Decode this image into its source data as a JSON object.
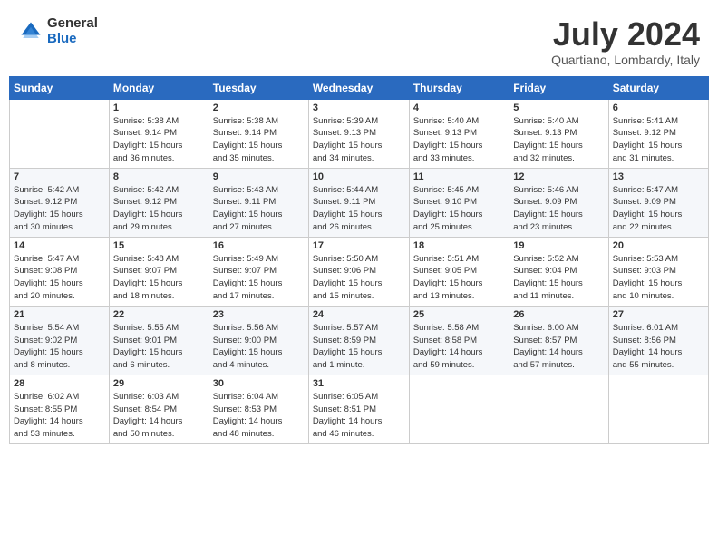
{
  "logo": {
    "general": "General",
    "blue": "Blue"
  },
  "title": {
    "month": "July 2024",
    "location": "Quartiano, Lombardy, Italy"
  },
  "days_of_week": [
    "Sunday",
    "Monday",
    "Tuesday",
    "Wednesday",
    "Thursday",
    "Friday",
    "Saturday"
  ],
  "weeks": [
    [
      {
        "day": "",
        "info": ""
      },
      {
        "day": "1",
        "info": "Sunrise: 5:38 AM\nSunset: 9:14 PM\nDaylight: 15 hours\nand 36 minutes."
      },
      {
        "day": "2",
        "info": "Sunrise: 5:38 AM\nSunset: 9:14 PM\nDaylight: 15 hours\nand 35 minutes."
      },
      {
        "day": "3",
        "info": "Sunrise: 5:39 AM\nSunset: 9:13 PM\nDaylight: 15 hours\nand 34 minutes."
      },
      {
        "day": "4",
        "info": "Sunrise: 5:40 AM\nSunset: 9:13 PM\nDaylight: 15 hours\nand 33 minutes."
      },
      {
        "day": "5",
        "info": "Sunrise: 5:40 AM\nSunset: 9:13 PM\nDaylight: 15 hours\nand 32 minutes."
      },
      {
        "day": "6",
        "info": "Sunrise: 5:41 AM\nSunset: 9:12 PM\nDaylight: 15 hours\nand 31 minutes."
      }
    ],
    [
      {
        "day": "7",
        "info": "Sunrise: 5:42 AM\nSunset: 9:12 PM\nDaylight: 15 hours\nand 30 minutes."
      },
      {
        "day": "8",
        "info": "Sunrise: 5:42 AM\nSunset: 9:12 PM\nDaylight: 15 hours\nand 29 minutes."
      },
      {
        "day": "9",
        "info": "Sunrise: 5:43 AM\nSunset: 9:11 PM\nDaylight: 15 hours\nand 27 minutes."
      },
      {
        "day": "10",
        "info": "Sunrise: 5:44 AM\nSunset: 9:11 PM\nDaylight: 15 hours\nand 26 minutes."
      },
      {
        "day": "11",
        "info": "Sunrise: 5:45 AM\nSunset: 9:10 PM\nDaylight: 15 hours\nand 25 minutes."
      },
      {
        "day": "12",
        "info": "Sunrise: 5:46 AM\nSunset: 9:09 PM\nDaylight: 15 hours\nand 23 minutes."
      },
      {
        "day": "13",
        "info": "Sunrise: 5:47 AM\nSunset: 9:09 PM\nDaylight: 15 hours\nand 22 minutes."
      }
    ],
    [
      {
        "day": "14",
        "info": "Sunrise: 5:47 AM\nSunset: 9:08 PM\nDaylight: 15 hours\nand 20 minutes."
      },
      {
        "day": "15",
        "info": "Sunrise: 5:48 AM\nSunset: 9:07 PM\nDaylight: 15 hours\nand 18 minutes."
      },
      {
        "day": "16",
        "info": "Sunrise: 5:49 AM\nSunset: 9:07 PM\nDaylight: 15 hours\nand 17 minutes."
      },
      {
        "day": "17",
        "info": "Sunrise: 5:50 AM\nSunset: 9:06 PM\nDaylight: 15 hours\nand 15 minutes."
      },
      {
        "day": "18",
        "info": "Sunrise: 5:51 AM\nSunset: 9:05 PM\nDaylight: 15 hours\nand 13 minutes."
      },
      {
        "day": "19",
        "info": "Sunrise: 5:52 AM\nSunset: 9:04 PM\nDaylight: 15 hours\nand 11 minutes."
      },
      {
        "day": "20",
        "info": "Sunrise: 5:53 AM\nSunset: 9:03 PM\nDaylight: 15 hours\nand 10 minutes."
      }
    ],
    [
      {
        "day": "21",
        "info": "Sunrise: 5:54 AM\nSunset: 9:02 PM\nDaylight: 15 hours\nand 8 minutes."
      },
      {
        "day": "22",
        "info": "Sunrise: 5:55 AM\nSunset: 9:01 PM\nDaylight: 15 hours\nand 6 minutes."
      },
      {
        "day": "23",
        "info": "Sunrise: 5:56 AM\nSunset: 9:00 PM\nDaylight: 15 hours\nand 4 minutes."
      },
      {
        "day": "24",
        "info": "Sunrise: 5:57 AM\nSunset: 8:59 PM\nDaylight: 15 hours\nand 1 minute."
      },
      {
        "day": "25",
        "info": "Sunrise: 5:58 AM\nSunset: 8:58 PM\nDaylight: 14 hours\nand 59 minutes."
      },
      {
        "day": "26",
        "info": "Sunrise: 6:00 AM\nSunset: 8:57 PM\nDaylight: 14 hours\nand 57 minutes."
      },
      {
        "day": "27",
        "info": "Sunrise: 6:01 AM\nSunset: 8:56 PM\nDaylight: 14 hours\nand 55 minutes."
      }
    ],
    [
      {
        "day": "28",
        "info": "Sunrise: 6:02 AM\nSunset: 8:55 PM\nDaylight: 14 hours\nand 53 minutes."
      },
      {
        "day": "29",
        "info": "Sunrise: 6:03 AM\nSunset: 8:54 PM\nDaylight: 14 hours\nand 50 minutes."
      },
      {
        "day": "30",
        "info": "Sunrise: 6:04 AM\nSunset: 8:53 PM\nDaylight: 14 hours\nand 48 minutes."
      },
      {
        "day": "31",
        "info": "Sunrise: 6:05 AM\nSunset: 8:51 PM\nDaylight: 14 hours\nand 46 minutes."
      },
      {
        "day": "",
        "info": ""
      },
      {
        "day": "",
        "info": ""
      },
      {
        "day": "",
        "info": ""
      }
    ]
  ]
}
